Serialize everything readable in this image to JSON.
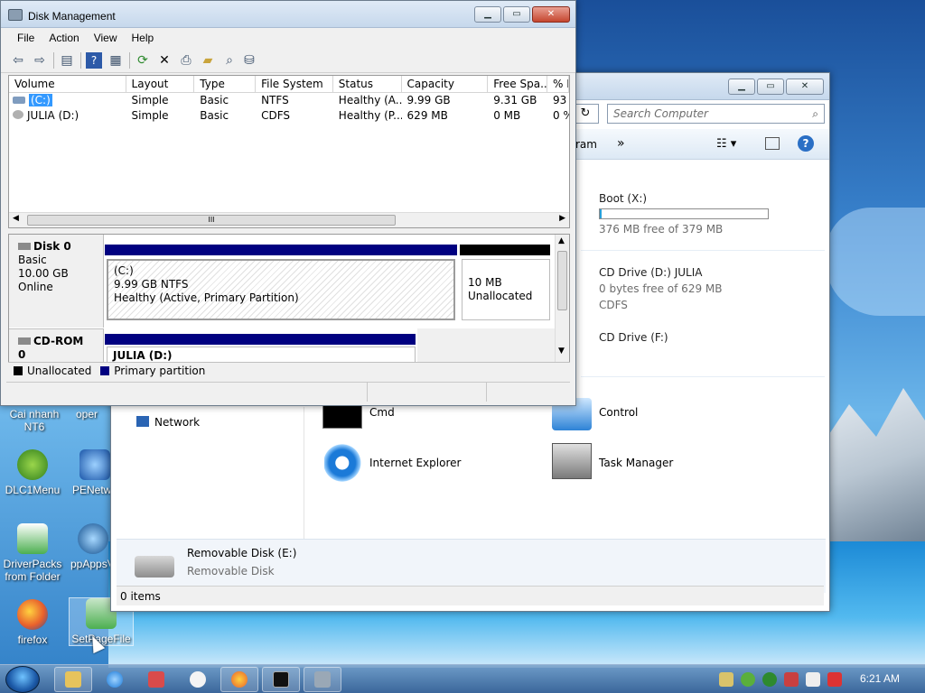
{
  "desktop": {
    "icons": [
      {
        "label": "Cai nhanh\nNT6"
      },
      {
        "label": "oper"
      },
      {
        "label": "DLC1Menu"
      },
      {
        "label": "PENetw"
      },
      {
        "label": "DriverPacks\nfrom Folder"
      },
      {
        "label": "ppAppsV"
      },
      {
        "label": "firefox"
      },
      {
        "label": "SetPageFile"
      }
    ]
  },
  "explorer": {
    "search_placeholder": "Search Computer",
    "address_arrow": "↻",
    "command_partial": "ram",
    "chevron": "»",
    "help": "?",
    "drives": [
      {
        "name": "Boot (X:)",
        "free": "376 MB free of 379 MB",
        "used_fraction": 0.008
      },
      {
        "name": "CD Drive (D:) JULIA",
        "free": "0 bytes free of 629 MB",
        "fs": "CDFS"
      },
      {
        "name": "CD Drive (F:)"
      }
    ],
    "network_label": "Network",
    "tiles": [
      {
        "label": "Cmd"
      },
      {
        "label": "Control"
      },
      {
        "label": "Internet Explorer"
      },
      {
        "label": "Task Manager"
      }
    ],
    "removable": {
      "name": "Removable Disk (E:)",
      "type": "Removable Disk"
    },
    "status": "0 items"
  },
  "diskmgmt": {
    "title": "Disk Management",
    "menu": [
      "File",
      "Action",
      "View",
      "Help"
    ],
    "columns": [
      "Volume",
      "Layout",
      "Type",
      "File System",
      "Status",
      "Capacity",
      "Free Spa...",
      "% F"
    ],
    "rows": [
      {
        "volume": "(C:)",
        "layout": "Simple",
        "type": "Basic",
        "fs": "NTFS",
        "status": "Healthy (A...",
        "capacity": "9.99 GB",
        "free": "9.31 GB",
        "pct": "93"
      },
      {
        "volume": "JULIA (D:)",
        "layout": "Simple",
        "type": "Basic",
        "fs": "CDFS",
        "status": "Healthy (P...",
        "capacity": "629 MB",
        "free": "0 MB",
        "pct": "0 %"
      }
    ],
    "scroll_grip": "III",
    "disk0": {
      "name": "Disk 0",
      "kind": "Basic",
      "size": "10.00 GB",
      "state": "Online",
      "partition": {
        "label": "(C:)",
        "size": "9.99 GB NTFS",
        "status": "Healthy (Active, Primary Partition)"
      },
      "unalloc": {
        "size": "10 MB",
        "label": "Unallocated"
      }
    },
    "cdrom0": {
      "name": "CD-ROM 0",
      "kind": "CD-ROM",
      "partition_label": "JULIA  (D:)"
    },
    "legend": {
      "unallocated": "Unallocated",
      "primary": "Primary partition"
    },
    "colors": {
      "primary": "#000080",
      "unallocated": "#000000",
      "selection": "#3399ff"
    }
  },
  "taskbar": {
    "clock": "6:21 AM"
  }
}
